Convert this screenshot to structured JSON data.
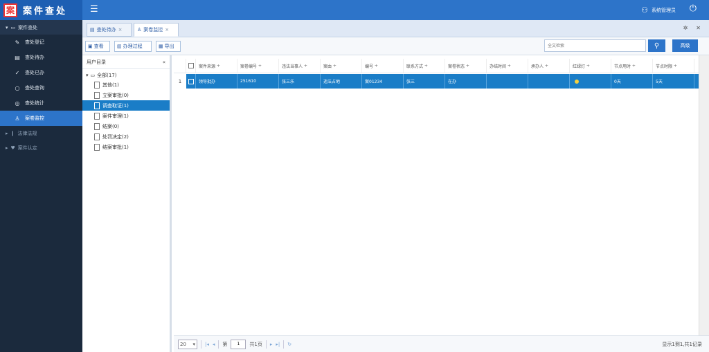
{
  "header": {
    "app_title": "案件查处",
    "logo_glyph": "案",
    "user_name": "系统管理员"
  },
  "sidebar": {
    "groups": [
      {
        "label": "案件查处",
        "expanded": true
      },
      {
        "label": "法律法规",
        "expanded": false
      },
      {
        "label": "案件认定",
        "expanded": false
      }
    ],
    "items": [
      {
        "label": "查处登记",
        "icon": "pencil-icon"
      },
      {
        "label": "查处待办",
        "icon": "list-icon"
      },
      {
        "label": "查处已办",
        "icon": "check-icon"
      },
      {
        "label": "查处查询",
        "icon": "search-icon"
      },
      {
        "label": "查处统计",
        "icon": "chart-icon"
      },
      {
        "label": "案卷监控",
        "icon": "user-icon",
        "active": true
      }
    ]
  },
  "tabs": [
    {
      "label": "查处待办",
      "icon": "list-icon",
      "closable": true
    },
    {
      "label": "案卷监控",
      "icon": "user-icon",
      "closable": true,
      "active": true
    }
  ],
  "toolbar": {
    "buttons": [
      {
        "label": "查看",
        "icon": "view-icon"
      },
      {
        "label": "办理过程",
        "icon": "flow-icon"
      },
      {
        "label": "导出",
        "icon": "export-icon"
      }
    ],
    "search_placeholder": "全文检索",
    "advanced_label": "高级"
  },
  "tree": {
    "header": "用户目录",
    "root_label": "全部(17)",
    "nodes": [
      {
        "label": "其他(1)"
      },
      {
        "label": "立案审批(0)"
      },
      {
        "label": "调查取证(1)",
        "active": true
      },
      {
        "label": "案件审理(1)"
      },
      {
        "label": "结案(0)"
      },
      {
        "label": "处罚决定(2)"
      },
      {
        "label": "结案审批(1)"
      }
    ]
  },
  "grid": {
    "columns": [
      "案件来源",
      "案卷编号",
      "违法当事人",
      "案由",
      "编号",
      "联系方式",
      "案卷状态",
      "办结时间",
      "承办人",
      "红绿灯",
      "节点用时",
      "节点时限"
    ],
    "rows": [
      {
        "num": "1",
        "cells": [
          "领导批办",
          "251610",
          "张三乐",
          "违法占地",
          "案01234",
          "张三",
          "在办",
          "",
          "",
          "",
          "0天",
          "5天"
        ],
        "light": "yellow"
      }
    ]
  },
  "pager": {
    "page_size": "20",
    "page_prefix": "第",
    "page_value": "1",
    "page_suffix": "共1页",
    "info": "显示1到1,共1记录"
  }
}
